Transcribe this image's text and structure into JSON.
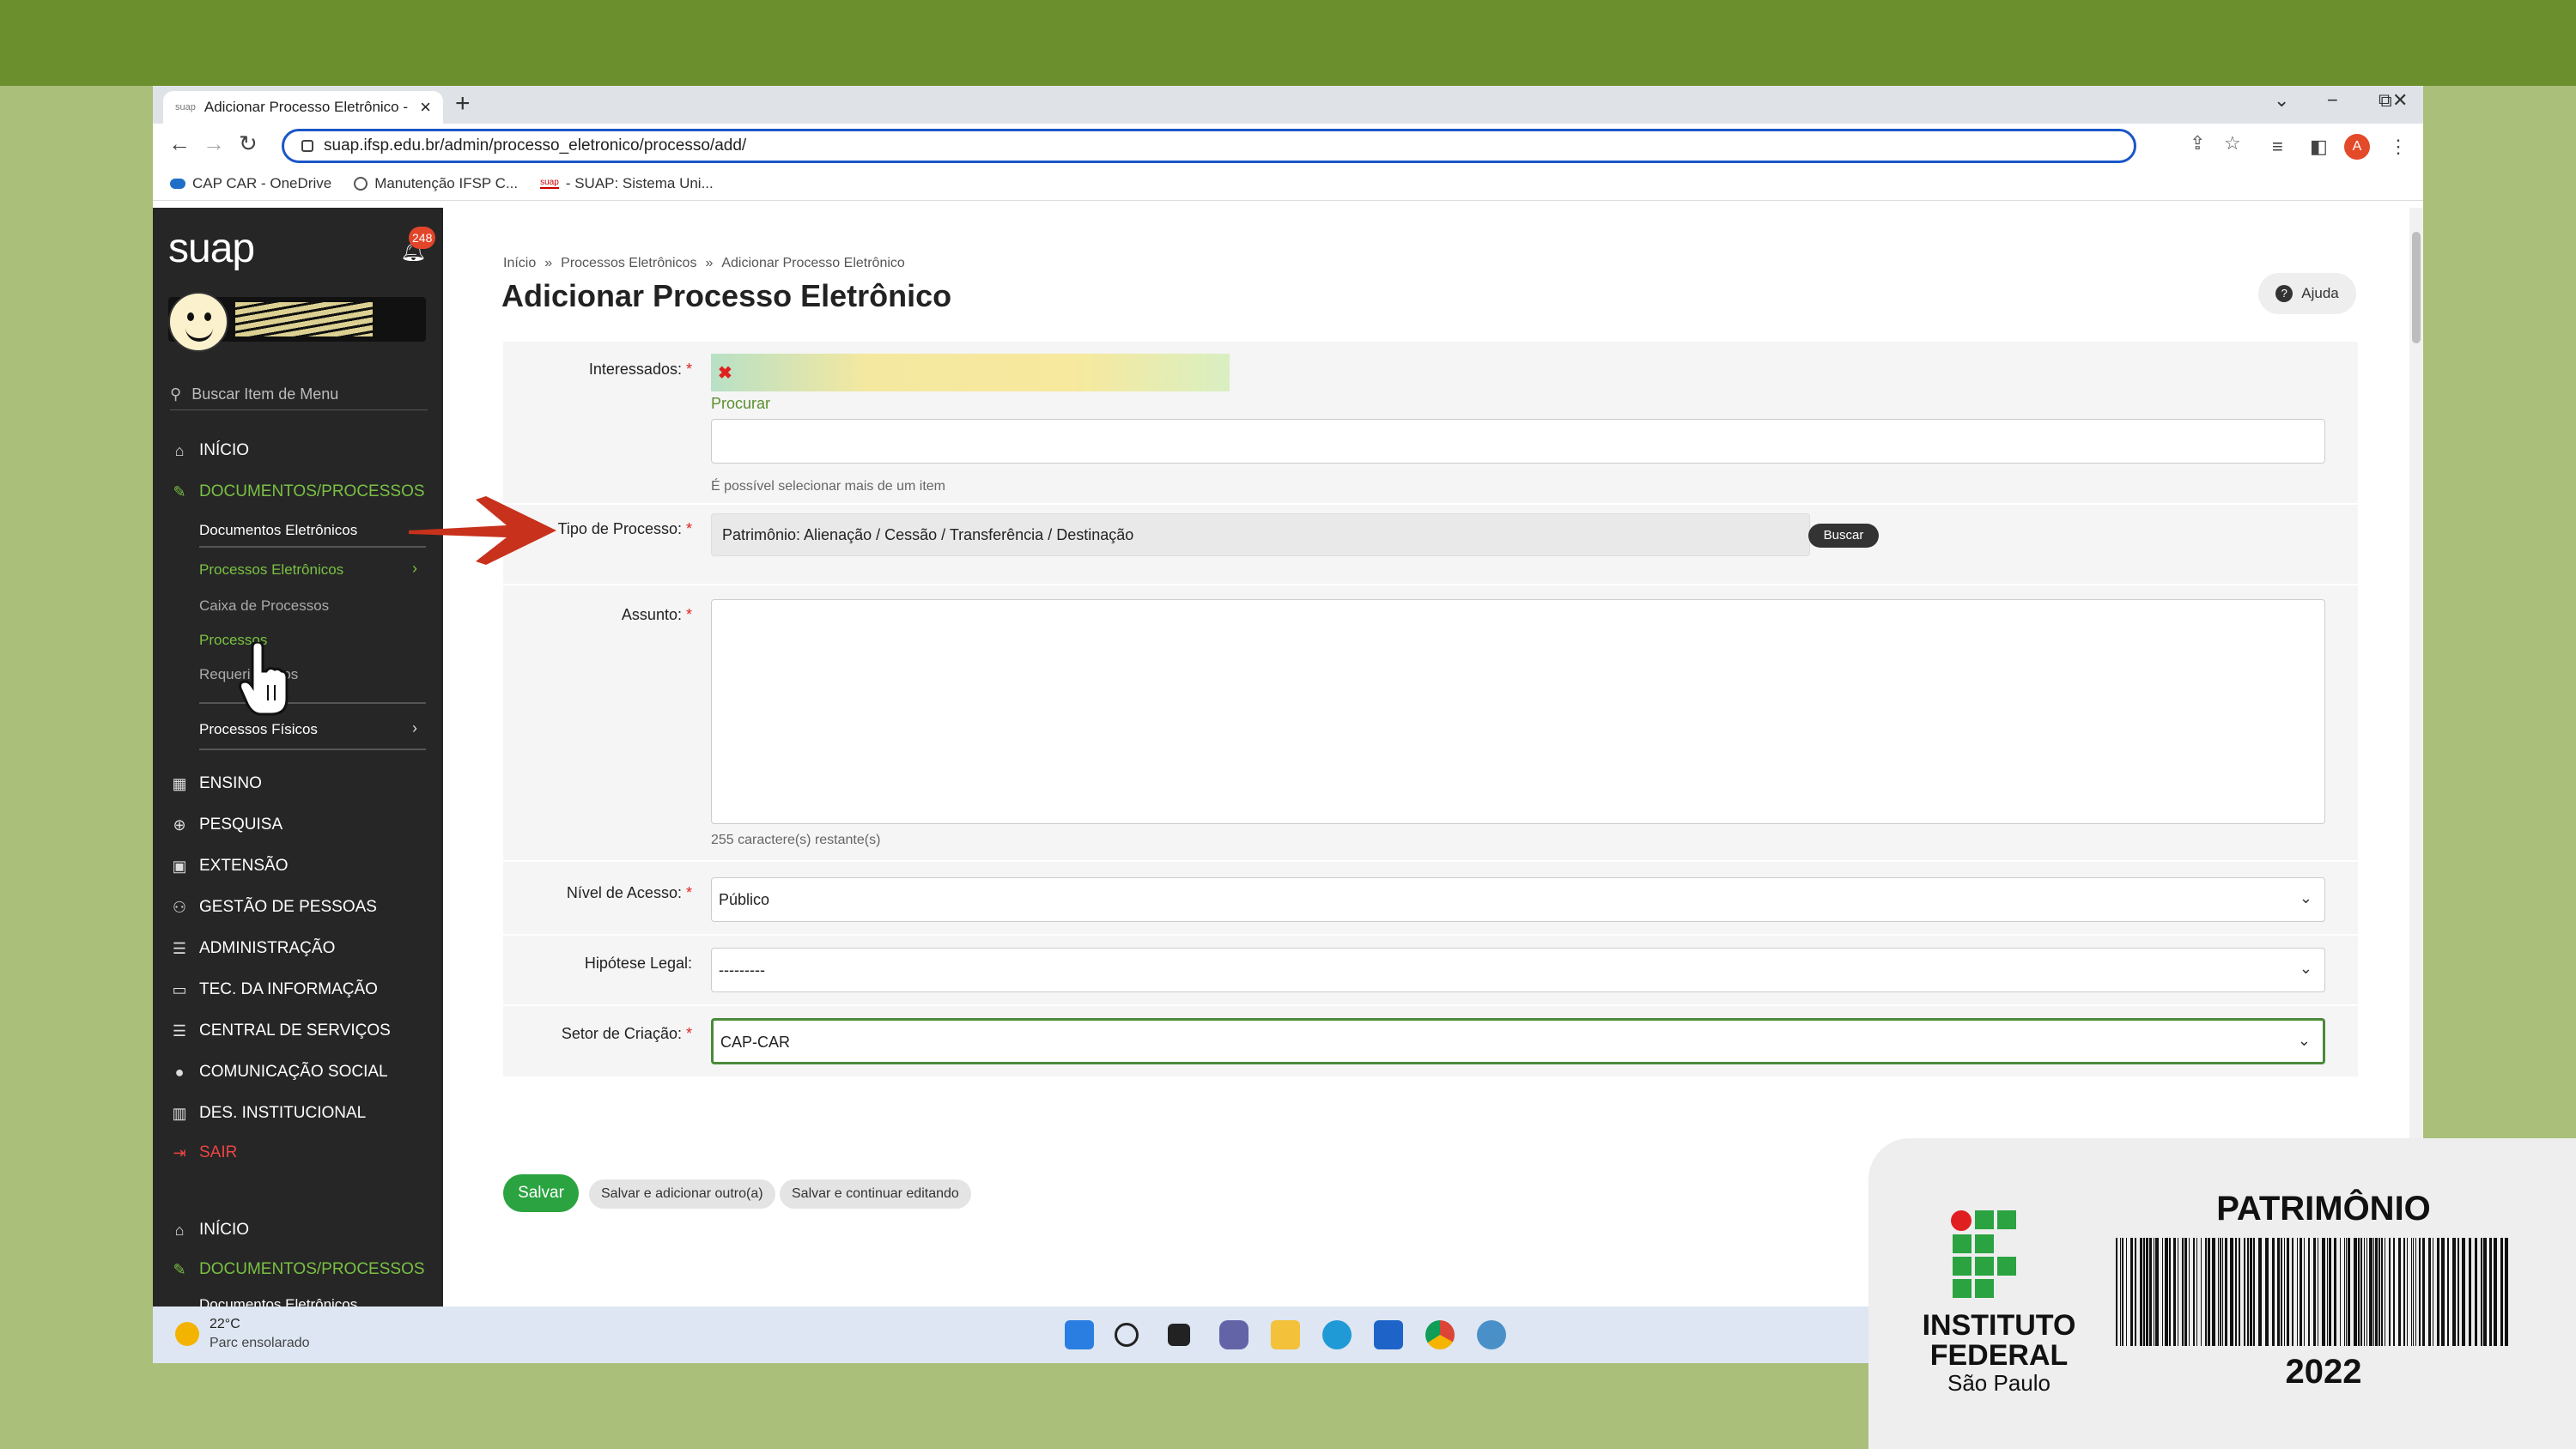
{
  "browser": {
    "tab_title": "Adicionar Processo Eletrônico - S",
    "tab_favicon": "suap",
    "new_tab": "+",
    "url": "suap.ifsp.edu.br/admin/processo_eletronico/processo/add/",
    "profile_initial": "A",
    "bookmarks": [
      {
        "label": "CAP CAR - OneDrive",
        "icon": "onedrive-icon"
      },
      {
        "label": "Manutenção IFSP C...",
        "icon": "globe-icon"
      },
      {
        "label": "- SUAP: Sistema Uni...",
        "icon": "suap-icon"
      }
    ]
  },
  "sidebar": {
    "logo": "suap",
    "notification_count": "248",
    "search_placeholder": "Buscar Item de Menu",
    "menu": {
      "inicio": "INÍCIO",
      "documentos": "DOCUMENTOS/PROCESSOS",
      "documentos_eletronicos": "Documentos Eletrônicos",
      "processos_eletronicos": "Processos Eletrônicos",
      "caixa": "Caixa de Processos",
      "processos": "Processos",
      "requerimentos": "Requerimentos",
      "processos_fisicos": "Processos Físicos",
      "ensino": "ENSINO",
      "pesquisa": "PESQUISA",
      "extensao": "EXTENSÃO",
      "gestao": "GESTÃO DE PESSOAS",
      "administracao": "ADMINISTRAÇÃO",
      "tec": "TEC. DA INFORMAÇÃO",
      "central": "CENTRAL DE SERVIÇOS",
      "comunicacao": "COMUNICAÇÃO SOCIAL",
      "des": "DES. INSTITUCIONAL",
      "sair": "SAIR",
      "inicio2": "INÍCIO",
      "documentos2": "DOCUMENTOS/PROCESSOS",
      "documentos_eletronicos2": "Documentos Eletrônicos"
    }
  },
  "page": {
    "breadcrumb": [
      "Início",
      "Processos Eletrônicos",
      "Adicionar Processo Eletrônico"
    ],
    "breadcrumb_sep": "»",
    "title": "Adicionar Processo Eletrônico",
    "help_label": "Ajuda"
  },
  "form": {
    "interessados_label": "Interessados:",
    "procurar": "Procurar",
    "multi_help": "É possível selecionar mais de um item",
    "tipo_label": "Tipo de Processo:",
    "tipo_value": "Patrimônio: Alienação / Cessão / Transferência / Destinação",
    "buscar": "Buscar",
    "assunto_label": "Assunto:",
    "assunto_help": "255 caractere(s) restante(s)",
    "nivel_label": "Nível de Acesso:",
    "nivel_value": "Público",
    "hipotese_label": "Hipótese Legal:",
    "hipotese_value": "---------",
    "setor_label": "Setor de Criação:",
    "setor_value": "CAP-CAR",
    "required_mark": "*"
  },
  "actions": {
    "salvar": "Salvar",
    "salvar_outro": "Salvar e adicionar outro(a)",
    "salvar_continuar": "Salvar e continuar editando"
  },
  "taskbar": {
    "temperature": "22°C",
    "weather": "Parc ensolarado"
  },
  "card": {
    "institute_line1": "INSTITUTO",
    "institute_line2": "FEDERAL",
    "institute_line3": "São Paulo",
    "title": "PATRIMÔNIO",
    "year": "2022"
  },
  "colors": {
    "top_band": "#6a8f2c",
    "background": "#aabf7a",
    "sidebar": "#262626",
    "accent_green": "#7ac143",
    "save_green": "#2aa340",
    "annotation_arrow": "#c8311c"
  }
}
